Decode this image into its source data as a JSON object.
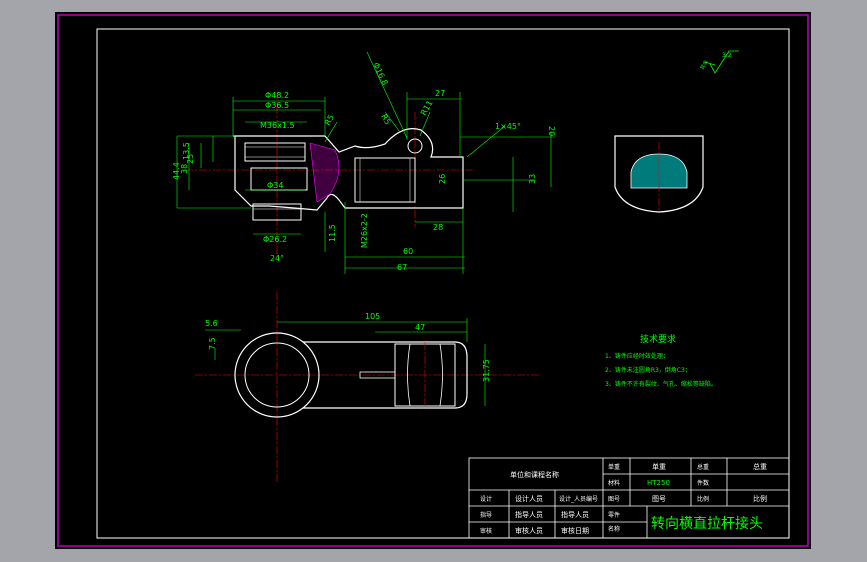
{
  "colors": {
    "background": "#a3a5aa",
    "canvas": "#000000",
    "outer_frame": "#c000c0",
    "border": "#ffffff",
    "geometry": "#ffffff",
    "dimension": "#00ff00",
    "centerline": "#ff0000",
    "hatch": "#00e0e0",
    "section": "#ff00ff"
  },
  "surface_finish": {
    "value": "3.2",
    "prefix": "其余"
  },
  "dimensions": {
    "d48": "Φ48.2",
    "d36": "Φ36.5",
    "thread": "M36x1.5",
    "d34": "Φ34",
    "d26": "Φ26.2",
    "angle": "24°",
    "r5": "R5",
    "d16": "Φ16.8",
    "r5b": "R5",
    "r11": "R11",
    "len27": "27",
    "chamfer": "1×45°",
    "h20": "20",
    "h13": "13.5",
    "h25": "25",
    "h38": "38",
    "h44": "44.4",
    "h26": "26",
    "h33": "33",
    "len28": "28",
    "len60": "60",
    "len67": "67",
    "thread2": "M26x2-2",
    "h11": "11.5",
    "len105": "105",
    "len47": "47",
    "len56": "5.6",
    "len75": "7.5",
    "h31": "31.75"
  },
  "tech_req": {
    "title": "技术要求",
    "items": [
      "1、铸件应经时效处理；",
      "2、铸件未注圆角R3，倒角C3；",
      "3、铸件不许有裂纹、气孔、缩松等缺陷。"
    ]
  },
  "title_block": {
    "company": "单位和课程名称",
    "r1": [
      "单重",
      "单重",
      "总重",
      "总重"
    ],
    "r2": [
      "材料",
      "HT250",
      "件数",
      ""
    ],
    "r3": [
      "设计",
      "设计人员",
      "设计_人员编号",
      "图号",
      "图号",
      "比例",
      "比例"
    ],
    "r4": [
      "指导",
      "指导人员",
      "指导人员"
    ],
    "r5": [
      "审核",
      "审核人员",
      "审核日期"
    ],
    "r45_left": [
      "零件",
      "名称"
    ],
    "part_name": "转向横直拉杆接头"
  }
}
